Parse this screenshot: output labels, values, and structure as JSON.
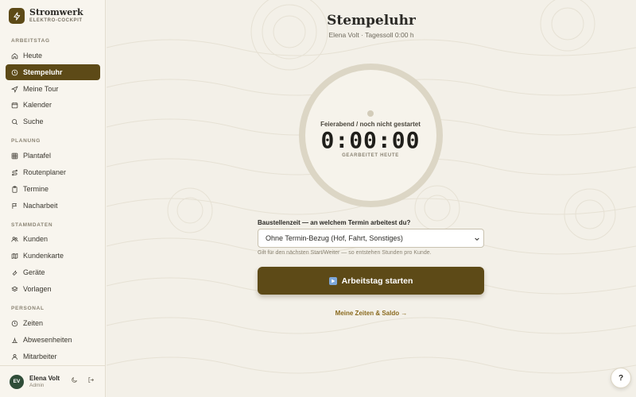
{
  "brand": {
    "name": "Stromwerk",
    "subtitle": "ELEKTRO-COCKPIT"
  },
  "sidebar": {
    "sections": [
      {
        "label": "ARBEITSTAG",
        "items": [
          {
            "label": "Heute",
            "icon": "home-icon"
          },
          {
            "label": "Stempeluhr",
            "icon": "clock-icon",
            "active": true
          },
          {
            "label": "Meine Tour",
            "icon": "navigation-icon"
          },
          {
            "label": "Kalender",
            "icon": "calendar-icon"
          },
          {
            "label": "Suche",
            "icon": "search-icon"
          }
        ]
      },
      {
        "label": "PLANUNG",
        "items": [
          {
            "label": "Plantafel",
            "icon": "grid-icon"
          },
          {
            "label": "Routenplaner",
            "icon": "route-icon"
          },
          {
            "label": "Termine",
            "icon": "clipboard-icon"
          },
          {
            "label": "Nacharbeit",
            "icon": "flag-icon"
          }
        ]
      },
      {
        "label": "STAMMDATEN",
        "items": [
          {
            "label": "Kunden",
            "icon": "users-icon"
          },
          {
            "label": "Kundenkarte",
            "icon": "map-icon"
          },
          {
            "label": "Geräte",
            "icon": "tool-icon"
          },
          {
            "label": "Vorlagen",
            "icon": "layers-icon"
          }
        ]
      },
      {
        "label": "PERSONAL",
        "items": [
          {
            "label": "Zeiten",
            "icon": "clock-icon"
          },
          {
            "label": "Abwesenheiten",
            "icon": "beach-icon"
          },
          {
            "label": "Mitarbeiter",
            "icon": "user-icon"
          }
        ]
      }
    ]
  },
  "user": {
    "initials": "EV",
    "name": "Elena Volt",
    "role": "Admin"
  },
  "page": {
    "title": "Stempeluhr",
    "subtitle": "Elena Volt · Tagessoll 0:00 h"
  },
  "clock": {
    "status": "Feierabend / noch nicht gestartet",
    "time": "0:00:00",
    "caption": "GEARBEITET HEUTE"
  },
  "assignment": {
    "label": "Baustellenzeit — an welchem Termin arbeitest du?",
    "selected": "Ohne Termin-Bezug (Hof, Fahrt, Sonstiges)",
    "hint": "Gilt für den nächsten Start/Weiter — so entstehen Stunden pro Kunde."
  },
  "actions": {
    "start_label": "Arbeitstag starten",
    "times_link": "Meine Zeiten & Saldo →",
    "help": "?"
  },
  "colors": {
    "accent": "#5d4a17",
    "background": "#f3f0e8",
    "avatar": "#2f4d38",
    "link": "#8a6a1e"
  }
}
